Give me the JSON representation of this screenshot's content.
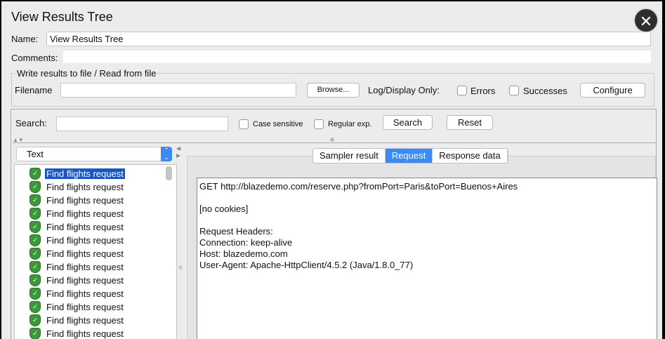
{
  "window": {
    "title": "View Results Tree",
    "close": "✕"
  },
  "name": {
    "label": "Name:",
    "value": "View Results Tree"
  },
  "comments": {
    "label": "Comments:",
    "value": ""
  },
  "file": {
    "legend": "Write results to file / Read from file",
    "filename_label": "Filename",
    "filename_value": "",
    "browse": "Browse...",
    "log_label": "Log/Display Only:",
    "errors": "Errors",
    "successes": "Successes",
    "configure": "Configure"
  },
  "search": {
    "label": "Search:",
    "value": "",
    "case_sensitive": "Case sensitive",
    "regex": "Regular exp.",
    "search_button": "Search",
    "reset_button": "Reset"
  },
  "renderer": {
    "selected": "Text"
  },
  "results": [
    "Find flights request",
    "Find flights request",
    "Find flights request",
    "Find flights request",
    "Find flights request",
    "Find flights request",
    "Find flights request",
    "Find flights request",
    "Find flights request",
    "Find flights request",
    "Find flights request",
    "Find flights request",
    "Find flights request"
  ],
  "tabs": [
    "Sampler result",
    "Request",
    "Response data"
  ],
  "active_tab": "Request",
  "request_lines": [
    "GET http://blazedemo.com/reserve.php?fromPort=Paris&toPort=Buenos+Aires",
    "",
    "[no cookies]",
    "",
    "Request Headers:",
    "Connection: keep-alive",
    "Host: blazedemo.com",
    "User-Agent: Apache-HttpClient/4.5.2 (Java/1.8.0_77)"
  ]
}
